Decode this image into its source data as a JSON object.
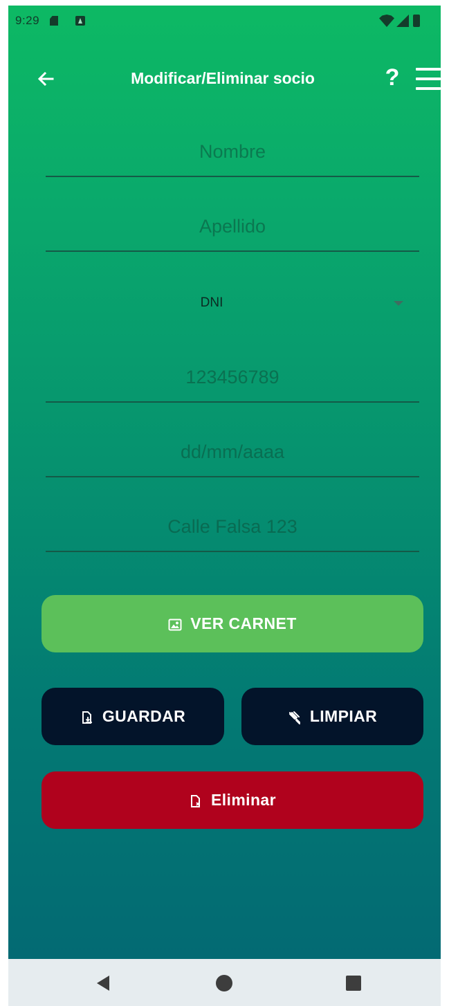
{
  "status_bar": {
    "time": "9:29",
    "icons": [
      "sd-card-icon",
      "a-notification-icon",
      "wifi-icon",
      "signal-icon",
      "battery-icon"
    ]
  },
  "app_bar": {
    "title": "Modificar/Eliminar socio",
    "back_icon": "arrow-left-icon",
    "help_label": "?",
    "menu_icon": "hamburger-menu-icon"
  },
  "form": {
    "nombre": {
      "value": "",
      "placeholder": "Nombre"
    },
    "apellido": {
      "value": "",
      "placeholder": "Apellido"
    },
    "tipo_documento": {
      "selected": "DNI"
    },
    "documento": {
      "value": "",
      "placeholder": "123456789"
    },
    "fecha_nacimiento": {
      "value": "",
      "placeholder": "dd/mm/aaaa"
    },
    "direccion": {
      "value": "",
      "placeholder": "Calle Falsa 123"
    }
  },
  "buttons": {
    "ver_carnet": {
      "label": "VER CARNET",
      "icon": "id-card-icon"
    },
    "guardar": {
      "label": "GUARDAR",
      "icon": "save-file-icon"
    },
    "limpiar": {
      "label": "LIMPIAR",
      "icon": "clear-icon"
    },
    "eliminar": {
      "label": "Eliminar",
      "icon": "delete-file-icon"
    }
  },
  "colors": {
    "gradient_top": "#0db964",
    "gradient_bottom": "#036a73",
    "carnet_button": "#5cc05a",
    "dark_button": "#03142a",
    "delete_button": "#b0021d"
  },
  "nav_bar": {
    "icons": [
      "nav-back-icon",
      "nav-home-icon",
      "nav-recent-icon"
    ]
  }
}
